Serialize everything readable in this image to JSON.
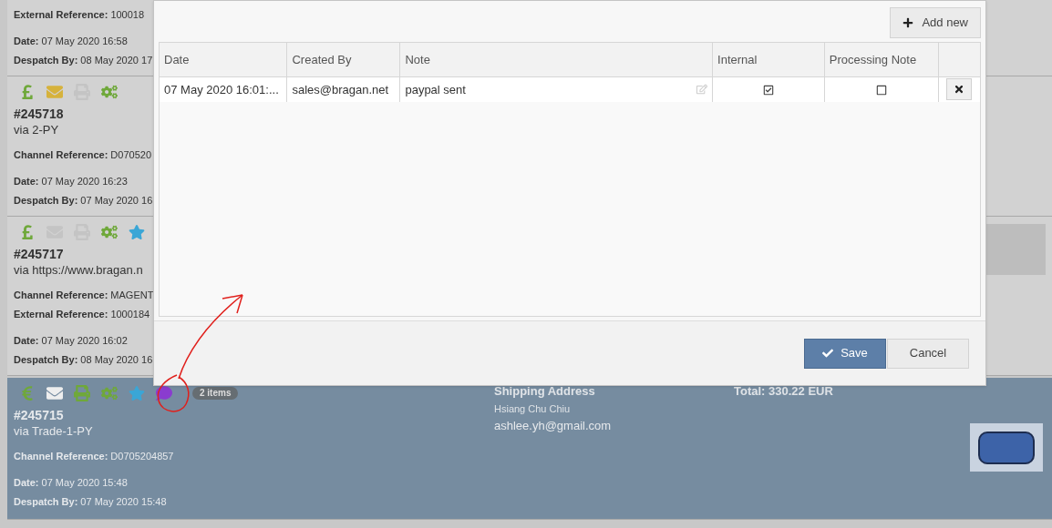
{
  "orders": [
    {
      "selected": false,
      "field_groups": [
        [
          "**External Reference:** 100018"
        ],
        [
          "**Date:** 07 May 2020 16:58",
          "**Despatch By:** 08 May 2020 17"
        ]
      ]
    },
    {
      "selected": false,
      "icons": [
        {
          "kind": "pound",
          "color": "#6fa83a"
        },
        {
          "kind": "mail",
          "color": "#d6b23c"
        },
        {
          "kind": "print",
          "color": "#c4c4c4"
        },
        {
          "kind": "gears",
          "color": "#6fa83a"
        }
      ],
      "number": "#245718",
      "via": "via 2-PY",
      "field_groups": [
        [
          "**Channel Reference:** D070520"
        ],
        [
          "**Date:** 07 May 2020 16:23",
          "**Despatch By:** 07 May 2020 16"
        ]
      ]
    },
    {
      "selected": false,
      "icons": [
        {
          "kind": "pound",
          "color": "#6fa83a"
        },
        {
          "kind": "mail",
          "color": "#c4c4c4"
        },
        {
          "kind": "print",
          "color": "#c4c4c4"
        },
        {
          "kind": "gears",
          "color": "#6fa83a"
        },
        {
          "kind": "star",
          "color": "#3aa6d6"
        }
      ],
      "number": "#245717",
      "via": "via https://www.bragan.n",
      "field_groups": [
        [
          "**Channel Reference:** MAGENT",
          "**External Reference:** 1000184"
        ],
        [
          "**Date:** 07 May 2020 16:02",
          "**Despatch By:** 08 May 2020 16"
        ]
      ]
    },
    {
      "selected": true,
      "icons": [
        {
          "kind": "euro",
          "color": "#6fa83a"
        },
        {
          "kind": "mail",
          "color": "#eeeeee"
        },
        {
          "kind": "print",
          "color": "#6fa83a"
        },
        {
          "kind": "gears",
          "color": "#6fa83a"
        },
        {
          "kind": "star",
          "color": "#3aa6d6"
        },
        {
          "kind": "chat",
          "color": "#8a3ccf"
        }
      ],
      "badge": "2 items",
      "number": "#245715",
      "via": "via Trade-1-PY",
      "field_groups": [
        [
          "**Channel Reference:** D0705204857"
        ],
        [
          "**Date:** 07 May 2020 15:48",
          "**Despatch By:** 07 May 2020 15:48"
        ]
      ],
      "shipping": {
        "heading": "Shipping Address",
        "name": "Hsiang Chu Chiu",
        "email": "ashlee.yh@gmail.com"
      },
      "total": "Total: 330.22 EUR"
    }
  ],
  "notes_dialog": {
    "add_button": "Add new",
    "columns": [
      "Date",
      "Created By",
      "Note",
      "Internal",
      "Processing Note"
    ],
    "rows": [
      {
        "date": "07 May 2020 16:01:...",
        "created_by": "sales@bragan.net",
        "note": "paypal sent",
        "internal": true,
        "processing_note": false
      }
    ],
    "save_button": "Save",
    "cancel_button": "Cancel"
  }
}
